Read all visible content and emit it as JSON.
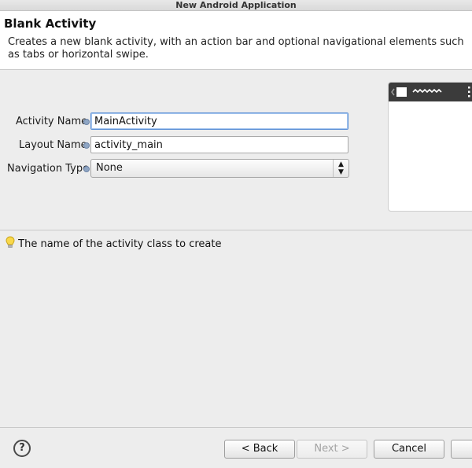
{
  "window": {
    "title": "New Android Application"
  },
  "header": {
    "title": "Blank Activity",
    "description": "Creates a new blank activity, with an action bar and optional navigational elements such as tabs or horizontal swipe."
  },
  "form": {
    "activity_name": {
      "label": "Activity Name",
      "value": "MainActivity"
    },
    "layout_name": {
      "label": "Layout Name",
      "value": "activity_main"
    },
    "navigation_type": {
      "label": "Navigation Type",
      "value": "None"
    }
  },
  "hint": {
    "icon": "lightbulb-icon",
    "text": "The name of the activity class to create"
  },
  "buttons": {
    "back": "< Back",
    "next": "Next >",
    "cancel": "Cancel",
    "finish": ""
  },
  "icons": {
    "help": "help-icon",
    "info": "info-icon",
    "preview": "activity-preview-thumbnail"
  },
  "colors": {
    "focus_border": "#5a8fd6",
    "background": "#ededed",
    "preview_actionbar": "#3b3b3b"
  }
}
